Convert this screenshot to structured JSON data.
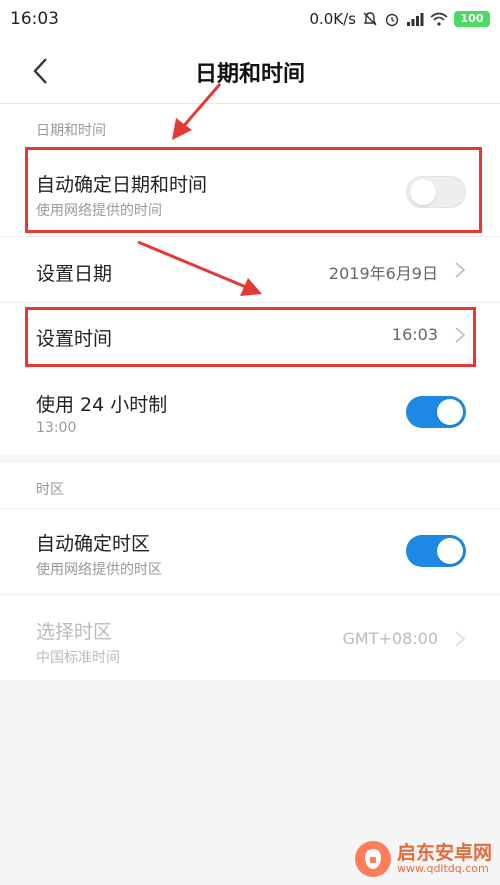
{
  "status_bar": {
    "time": "16:03",
    "network_speed": "0.0K/s",
    "battery": "100",
    "icons": [
      "bell-mute-icon",
      "alarm-icon",
      "signal-icon",
      "wifi-icon",
      "battery-icon"
    ]
  },
  "header": {
    "title": "日期和时间",
    "back_icon": "chevron-left-icon"
  },
  "section_datetime": {
    "label": "日期和时间",
    "auto_datetime": {
      "title": "自动确定日期和时间",
      "subtitle": "使用网络提供的时间",
      "toggle_on": false
    },
    "set_date": {
      "title": "设置日期",
      "value": "2019年6月9日"
    },
    "set_time": {
      "title": "设置时间",
      "value": "16:03"
    },
    "use_24h": {
      "title": "使用 24 小时制",
      "subtitle": "13:00",
      "toggle_on": true
    }
  },
  "section_timezone": {
    "label": "时区",
    "auto_timezone": {
      "title": "自动确定时区",
      "subtitle": "使用网络提供的时区",
      "toggle_on": true
    },
    "select_timezone": {
      "title": "选择时区",
      "subtitle": "中国标准时间",
      "value": "GMT+08:00"
    }
  },
  "watermark": {
    "title": "启东安卓网",
    "url": "www.qdltdq.com"
  },
  "colors": {
    "accent": "#1e88e5",
    "annotation": "#e53935",
    "background": "#f5f5f5"
  }
}
